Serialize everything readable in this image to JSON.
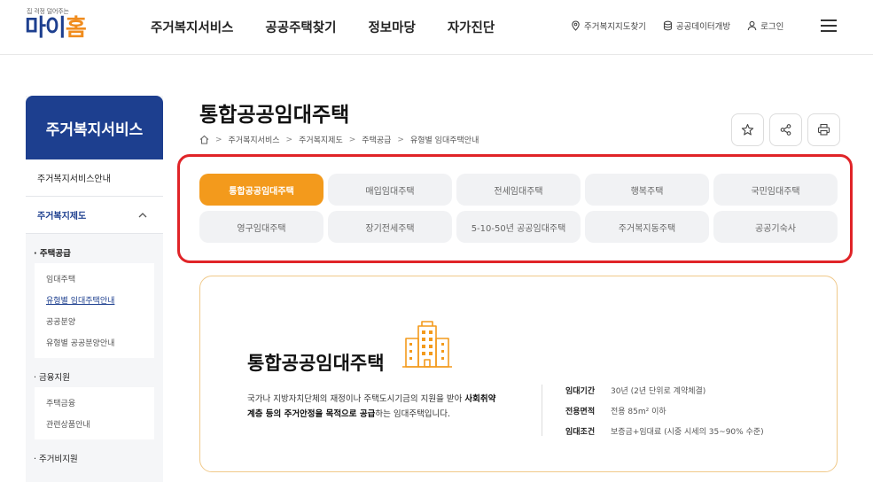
{
  "header": {
    "logo_tagline": "집 걱정 덜어주는",
    "logo_main_a": "마이",
    "logo_main_b": "홈",
    "nav": [
      "주거복지서비스",
      "공공주택찾기",
      "정보마당",
      "자가진단"
    ],
    "util": [
      {
        "label": "주거복지지도찾기",
        "icon": "map-pin-icon"
      },
      {
        "label": "공공데이터개방",
        "icon": "database-icon"
      },
      {
        "label": "로그인",
        "icon": "user-icon"
      }
    ]
  },
  "sidebar": {
    "title": "주거복지서비스",
    "items": [
      "주거복지서비스안내",
      "주거복지제도"
    ],
    "groups": [
      {
        "label": "주택공급",
        "items": [
          "임대주택",
          "유형별 임대주택안내",
          "공공분양",
          "유형별 공공분양안내"
        ]
      },
      {
        "label": "금융지원",
        "items": [
          "주택금융",
          "관련상품안내"
        ]
      },
      {
        "label": "주거비지원"
      }
    ]
  },
  "main": {
    "title": "통합공공임대주택",
    "breadcrumb": [
      "주거복지서비스",
      "주거복지제도",
      "주택공급",
      "유형별 임대주택안내"
    ]
  },
  "tabs": [
    "통합공공임대주택",
    "매입임대주택",
    "전세임대주택",
    "행복주택",
    "국민임대주택",
    "영구임대주택",
    "장기전세주택",
    "5-10-50년 공공임대주택",
    "주거복지동주택",
    "공공기숙사"
  ],
  "card": {
    "title": "통합공공임대주택",
    "desc_1": "국가나 지방자치단체의 재정이나 주택도시기금의 지원을 받아 ",
    "desc_2": "사회취약계층 등의 주거안정을 목적으로 공급",
    "desc_3": "하는 임대주택입니다.",
    "specs": [
      {
        "k": "임대기간",
        "v": "30년 (2년 단위로 계약체결)"
      },
      {
        "k": "전용면적",
        "v": "전용 85m² 이하"
      },
      {
        "k": "임대조건",
        "v": "보증금+임대료 (시중 시세의 35~90% 수준)"
      }
    ]
  },
  "colors": {
    "accent": "#f39a1c",
    "brand": "#1d3f8f",
    "highlight": "#e02428"
  }
}
